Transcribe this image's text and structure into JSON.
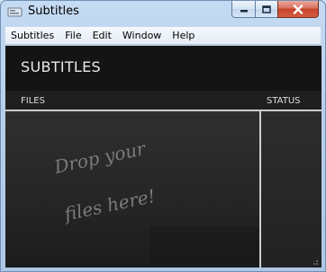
{
  "window": {
    "title": "Subtitles",
    "controls": {
      "minimize": "minimize",
      "maximize": "maximize",
      "close": "close"
    }
  },
  "menu": {
    "items": [
      "Subtitles",
      "File",
      "Edit",
      "Window",
      "Help"
    ]
  },
  "app": {
    "heading": "SUBTITLES",
    "columns": {
      "files": "FILES",
      "status": "STATUS"
    },
    "drop_hint_line1": "Drop your",
    "drop_hint_line2": "files here!"
  },
  "colors": {
    "panel_bg": "#1f1f1f",
    "divider": "#cfcfcf",
    "close_button": "#c7442b"
  },
  "icons": [
    "app-icon",
    "minimize-icon",
    "maximize-icon",
    "close-icon",
    "resize-grip-icon"
  ]
}
